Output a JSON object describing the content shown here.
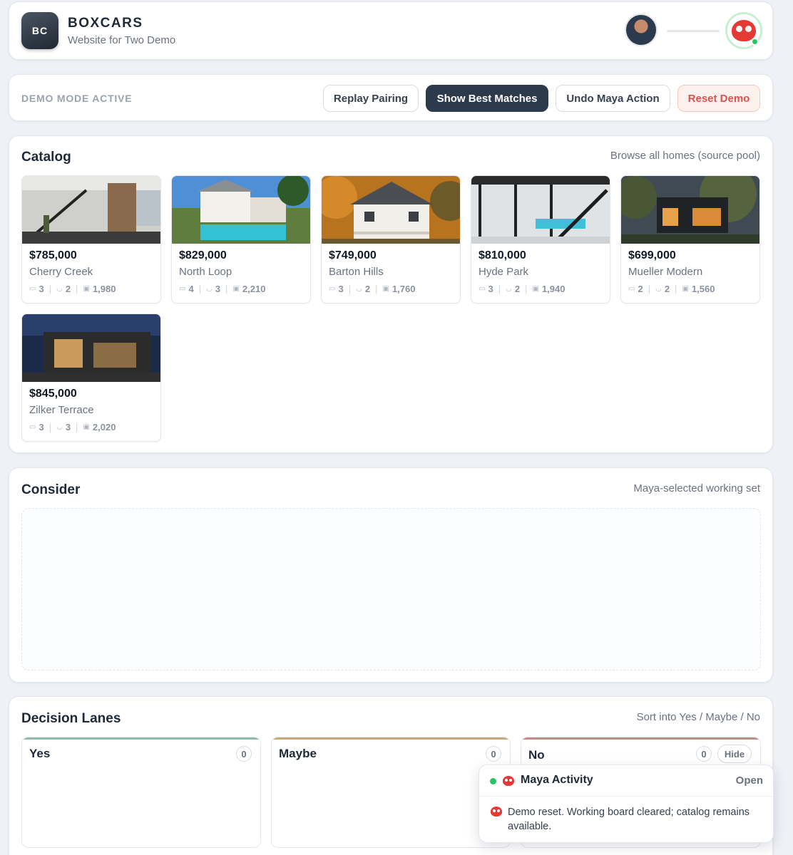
{
  "header": {
    "logo_text": "BC",
    "title": "BOXCARS",
    "subtitle": "Website for Two Demo"
  },
  "demo_bar": {
    "status": "DEMO MODE ACTIVE",
    "buttons": {
      "replay": "Replay Pairing",
      "best": "Show Best Matches",
      "undo": "Undo Maya Action",
      "reset": "Reset Demo"
    }
  },
  "catalog": {
    "title": "Catalog",
    "subtitle": "Browse all homes (source pool)",
    "homes": [
      {
        "price": "$785,000",
        "name": "Cherry Creek",
        "beds": "3",
        "baths": "2",
        "sqft": "1,980"
      },
      {
        "price": "$829,000",
        "name": "North Loop",
        "beds": "4",
        "baths": "3",
        "sqft": "2,210"
      },
      {
        "price": "$749,000",
        "name": "Barton Hills",
        "beds": "3",
        "baths": "2",
        "sqft": "1,760"
      },
      {
        "price": "$810,000",
        "name": "Hyde Park",
        "beds": "3",
        "baths": "2",
        "sqft": "1,940"
      },
      {
        "price": "$699,000",
        "name": "Mueller Modern",
        "beds": "2",
        "baths": "2",
        "sqft": "1,560"
      },
      {
        "price": "$845,000",
        "name": "Zilker Terrace",
        "beds": "3",
        "baths": "3",
        "sqft": "2,020"
      }
    ]
  },
  "consider": {
    "title": "Consider",
    "subtitle": "Maya-selected working set"
  },
  "lanes": {
    "title": "Decision Lanes",
    "subtitle": "Sort into Yes / Maybe / No",
    "yes": {
      "label": "Yes",
      "count": "0"
    },
    "maybe": {
      "label": "Maybe",
      "count": "0"
    },
    "no": {
      "label": "No",
      "count": "0",
      "hide_label": "Hide"
    }
  },
  "activity": {
    "title": "Maya Activity",
    "open_label": "Open",
    "message": "Demo reset. Working board cleared; catalog remains available."
  },
  "colors": {
    "primary_button": "#2d3a4b",
    "reset_accent": "#d9534f",
    "online": "#22c55e",
    "maya_red": "#e53935"
  }
}
